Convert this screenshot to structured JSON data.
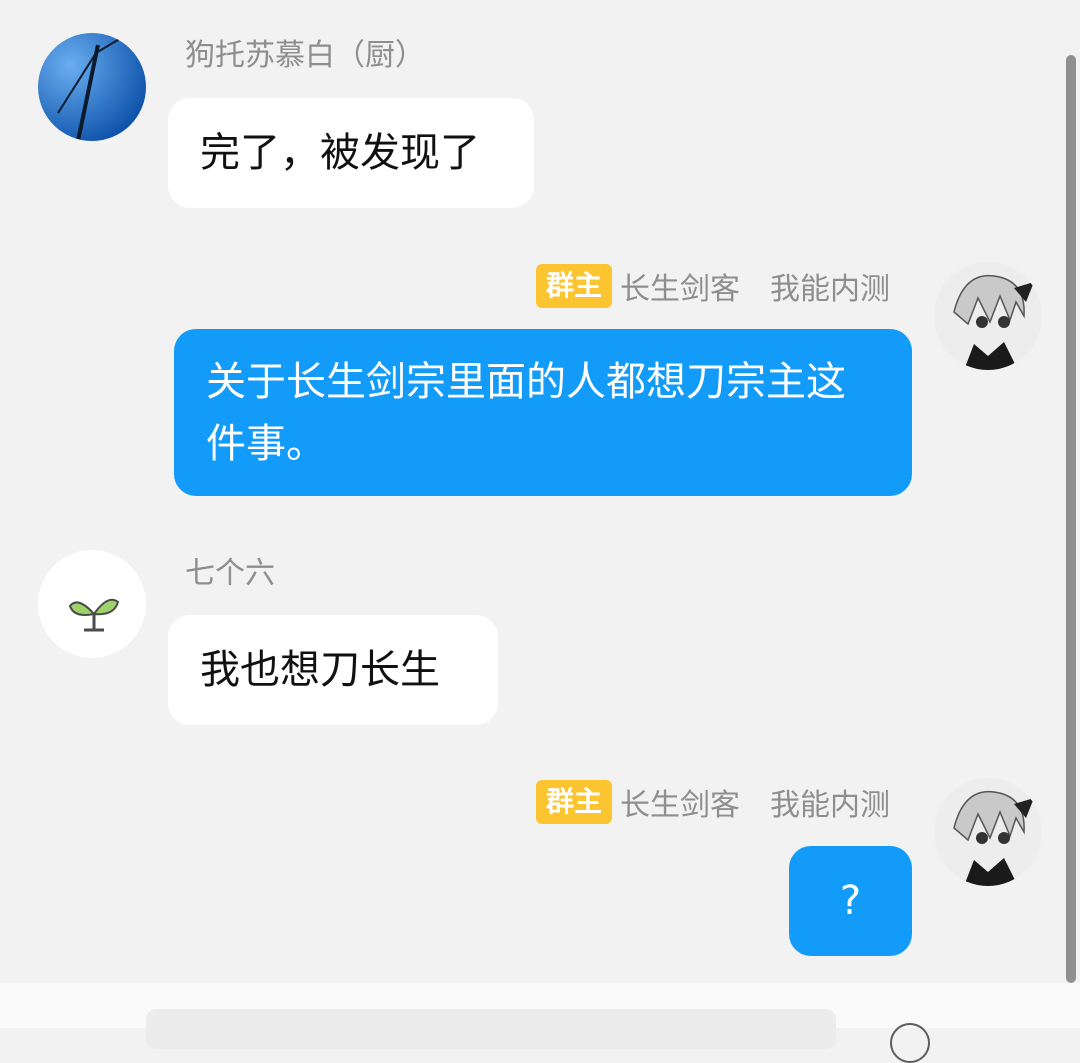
{
  "messages": [
    {
      "sender": "狗托苏慕白（厨）",
      "text": "完了，被发现了",
      "direction": "in",
      "avatar_icon": "wind-turbine-avatar"
    },
    {
      "badge": "群主",
      "sender": "长生剑客",
      "sender_title": "我能内测",
      "text": "关于长生剑宗里面的人都想刀宗主这件事。",
      "direction": "out",
      "avatar_icon": "anime-character-avatar"
    },
    {
      "sender": "七个六",
      "text": "我也想刀长生",
      "direction": "in",
      "avatar_icon": "sprout-avatar"
    },
    {
      "badge": "群主",
      "sender": "长生剑客",
      "sender_title": "我能内测",
      "text": "?",
      "direction": "out",
      "avatar_icon": "anime-character-avatar"
    }
  ],
  "colors": {
    "outgoing_bubble": "#129bf8",
    "incoming_bubble": "#ffffff",
    "owner_badge": "#fcc430",
    "background": "#f2f2f2"
  }
}
